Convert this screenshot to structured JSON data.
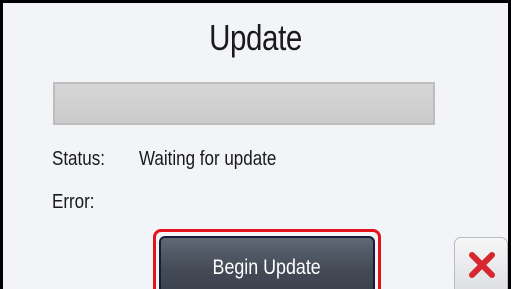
{
  "dialog": {
    "title": "Update",
    "progress": {
      "fraction": 0,
      "track_color": "#cfcfcf",
      "fill_color": "#3a7d3a"
    },
    "status_label": "Status:",
    "status_value": "Waiting for update",
    "error_label": "Error:",
    "error_value": "",
    "begin_button_label": "Begin Update",
    "highlight_color": "#e3131b",
    "close_icon": "close-x-icon",
    "close_icon_color": "#d7262d"
  }
}
